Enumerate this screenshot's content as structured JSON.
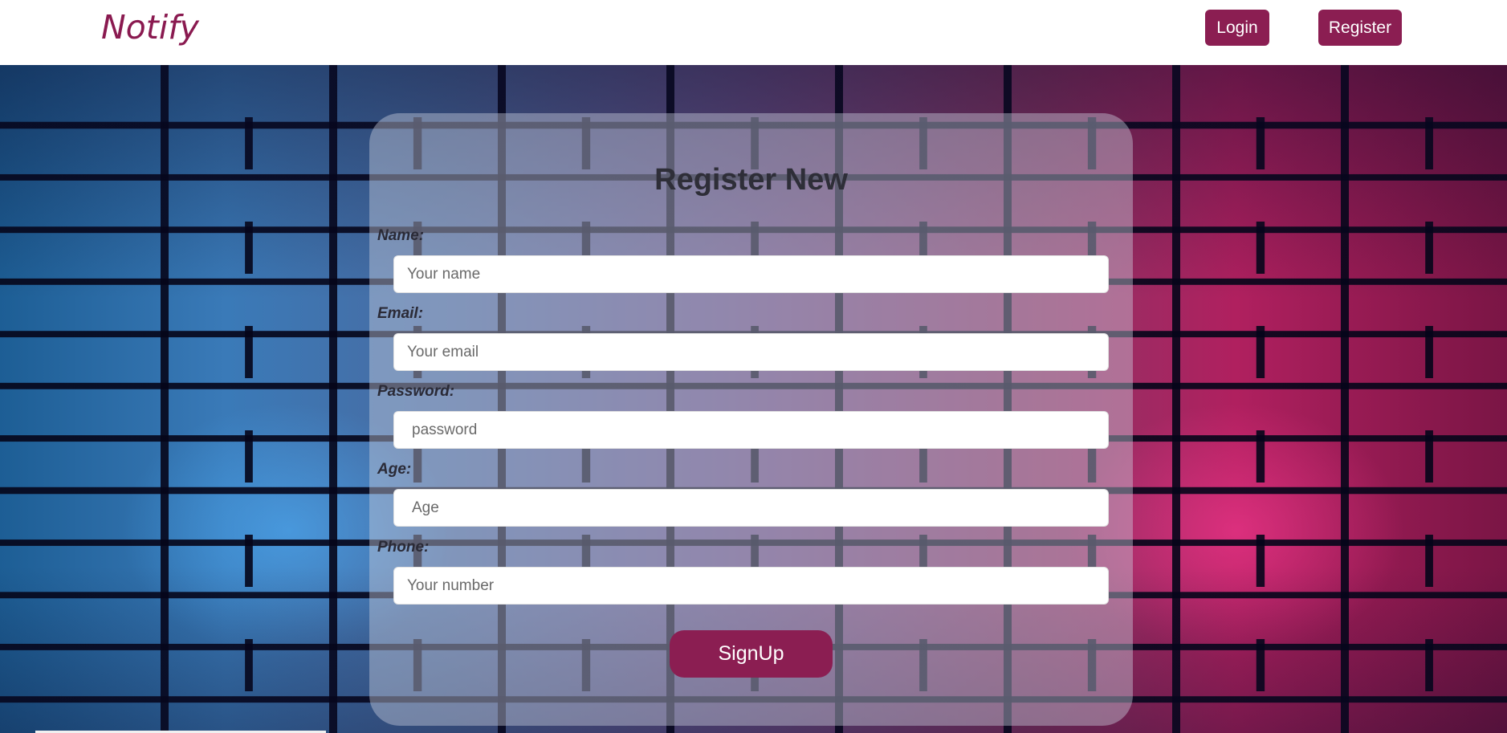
{
  "navbar": {
    "brand": "Notify",
    "login_label": "Login",
    "register_label": "Register"
  },
  "form": {
    "title": "Register New",
    "fields": [
      {
        "label": "Name:",
        "placeholder": "Your name"
      },
      {
        "label": "Email:",
        "placeholder": "Your email"
      },
      {
        "label": "Password:",
        "placeholder": "password"
      },
      {
        "label": "Age:",
        "placeholder": "Age"
      },
      {
        "label": "Phone:",
        "placeholder": "Your number"
      }
    ],
    "submit_label": "SignUp"
  },
  "colors": {
    "brand": "#8a1a50",
    "button": "#8b1e52"
  }
}
